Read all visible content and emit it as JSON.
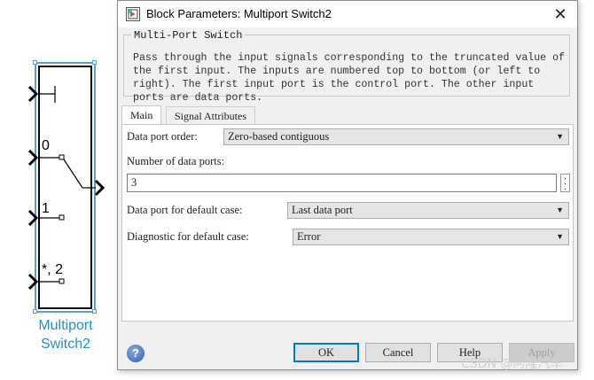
{
  "model": {
    "block_name_line1": "Multiport",
    "block_name_line2": "Switch2",
    "port_labels": [
      "0",
      "1",
      "*, 2"
    ]
  },
  "dialog": {
    "title": "Block Parameters: Multiport Switch2",
    "icons": {
      "title": "simulink-block-icon",
      "close": "close-icon",
      "help": "help-icon"
    },
    "group_title": "Multi-Port Switch",
    "description": "Pass through the input signals corresponding to the truncated value of the first input. The inputs are numbered top to bottom (or left to right). The first input port is the control port. The other input ports are data ports.",
    "tabs": {
      "main": "Main",
      "signal": "Signal Attributes"
    },
    "fields": {
      "data_port_order_label": "Data port order:",
      "data_port_order_value": "Zero-based contiguous",
      "num_ports_label": "Number of data ports:",
      "num_ports_value": "3",
      "default_case_label": "Data port for default case:",
      "default_case_value": "Last data port",
      "diagnostic_label": "Diagnostic for default case:",
      "diagnostic_value": "Error"
    },
    "buttons": {
      "ok": "OK",
      "cancel": "Cancel",
      "help": "Help",
      "apply": "Apply"
    }
  },
  "watermark": "CSDN @阿隆汽车",
  "colors": {
    "selection": "#5aa0d8",
    "block_name": "#1f8fd6",
    "ok_border": "#0078d7"
  }
}
